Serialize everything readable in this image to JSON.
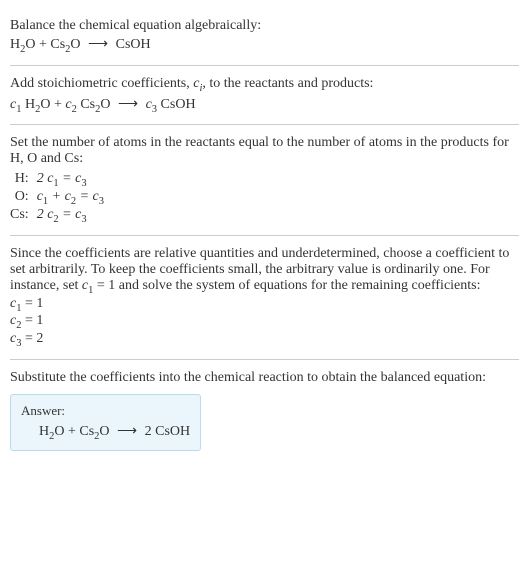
{
  "section1": {
    "title": "Balance the chemical equation algebraically:",
    "eq_h2o": "H",
    "eq_h2o_sub": "2",
    "eq_h2o_o": "O + Cs",
    "eq_cs2o_sub": "2",
    "eq_cs2o_o": "O ",
    "arrow": "⟶",
    "eq_rhs": " CsOH"
  },
  "section2": {
    "title_a": "Add stoichiometric coefficients, ",
    "title_ci": "c",
    "title_ci_sub": "i",
    "title_b": ", to the reactants and products:",
    "c1": "c",
    "c1_sub": "1",
    "sp1": " H",
    "h2_sub": "2",
    "sp2": "O + ",
    "c2": "c",
    "c2_sub": "2",
    "sp3": " Cs",
    "cs2_sub": "2",
    "sp4": "O ",
    "arrow": "⟶",
    "sp5": " ",
    "c3": "c",
    "c3_sub": "3",
    "sp6": " CsOH"
  },
  "section3": {
    "title": "Set the number of atoms in the reactants equal to the number of atoms in the products for H, O and Cs:",
    "rows": {
      "h_label": "H:",
      "h_eq_a": "2 c",
      "h_eq_s1": "1",
      "h_eq_b": " = c",
      "h_eq_s2": "3",
      "o_label": "O:",
      "o_eq_a": "c",
      "o_eq_s1": "1",
      "o_eq_b": " + c",
      "o_eq_s2": "2",
      "o_eq_c": " = c",
      "o_eq_s3": "3",
      "cs_label": "Cs:",
      "cs_eq_a": "2 c",
      "cs_eq_s1": "2",
      "cs_eq_b": " = c",
      "cs_eq_s2": "3"
    }
  },
  "section4": {
    "title_a": "Since the coefficients are relative quantities and underdetermined, choose a coefficient to set arbitrarily. To keep the coefficients small, the arbitrary value is ordinarily one. For instance, set ",
    "c1": "c",
    "c1_sub": "1",
    "title_b": " = 1 and solve the system of equations for the remaining coefficients:",
    "l1_a": "c",
    "l1_sub": "1",
    "l1_b": " = 1",
    "l2_a": "c",
    "l2_sub": "2",
    "l2_b": " = 1",
    "l3_a": "c",
    "l3_sub": "3",
    "l3_b": " = 2"
  },
  "section5": {
    "title": "Substitute the coefficients into the chemical reaction to obtain the balanced equation:",
    "answer_label": "Answer:",
    "eq_a": "H",
    "eq_h2_sub": "2",
    "eq_b": "O + Cs",
    "eq_cs2_sub": "2",
    "eq_c": "O ",
    "arrow": "⟶",
    "eq_d": " 2 CsOH"
  }
}
